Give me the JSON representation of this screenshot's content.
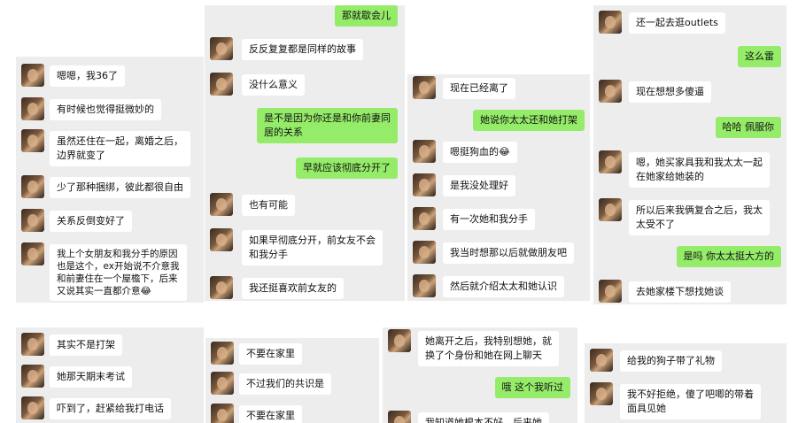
{
  "colors": {
    "panel_bg": "#ededed",
    "incoming_bubble": "#ffffff",
    "outgoing_bubble": "#95ec69"
  },
  "icons": {
    "avatar": "contact-avatar-photo"
  },
  "panels": {
    "p1": [
      {
        "dir": "in",
        "text": "嗯嗯，我36了"
      },
      {
        "dir": "in",
        "text": "有时候也觉得挺微妙的"
      },
      {
        "dir": "in",
        "text": "虽然还住在一起，离婚之后，\n边界就变了"
      },
      {
        "dir": "in",
        "text": "少了那种捆绑，彼此都很自由"
      },
      {
        "dir": "in",
        "text": "关系反倒变好了"
      },
      {
        "dir": "in",
        "text": "我上个女朋友和我分手的原因\n也是这个，ex开始说不介意我\n和前妻住在一个屋檐下，后来\n又说其实一直都介意😂"
      }
    ],
    "p2": [
      {
        "dir": "out",
        "text": "那就歇会儿"
      },
      {
        "dir": "in",
        "text": "反反复复都是同样的故事"
      },
      {
        "dir": "in",
        "text": "没什么意义"
      },
      {
        "dir": "out",
        "text": "是不是因为你还是和你前妻同\n居的关系"
      },
      {
        "dir": "out",
        "text": "早就应该彻底分开了"
      },
      {
        "dir": "in",
        "text": "也有可能"
      },
      {
        "dir": "in",
        "text": "如果早彻底分开，前女友不会\n和我分手"
      },
      {
        "dir": "in",
        "text": "我还挺喜欢前女友的"
      }
    ],
    "p3": [
      {
        "dir": "in",
        "text": "现在已经离了"
      },
      {
        "dir": "out",
        "text": "她说你太太还和她打架"
      },
      {
        "dir": "in",
        "text": "嗯挺狗血的😂"
      },
      {
        "dir": "in",
        "text": "是我没处理好"
      },
      {
        "dir": "in",
        "text": "有一次她和我分手"
      },
      {
        "dir": "in",
        "text": "我当时想那以后就做朋友吧"
      },
      {
        "dir": "in",
        "text": "然后就介绍太太和她认识"
      }
    ],
    "p4": [
      {
        "dir": "in",
        "text": "还一起去逛outlets"
      },
      {
        "dir": "out",
        "text": "这么雷"
      },
      {
        "dir": "in",
        "text": "现在想想多傻逼"
      },
      {
        "dir": "out",
        "text": "哈哈 佩服你"
      },
      {
        "dir": "in",
        "text": "嗯，她买家具我和我太太一起\n在她家给她装的"
      },
      {
        "dir": "in",
        "text": "所以后来我俩复合之后，我太\n太受不了"
      },
      {
        "dir": "out",
        "text": "是吗 你太太挺大方的"
      },
      {
        "dir": "in",
        "text": "去她家楼下想找她谈"
      }
    ],
    "p5": [
      {
        "dir": "in",
        "text": "其实不是打架"
      },
      {
        "dir": "in",
        "text": "她那天期末考试"
      },
      {
        "dir": "in",
        "text": "吓到了，赶紧给我打电话"
      }
    ],
    "p6": [
      {
        "dir": "in",
        "text": "不要在家里"
      },
      {
        "dir": "in",
        "text": "不过我们的共识是"
      },
      {
        "dir": "in",
        "text": "不要在家里"
      }
    ],
    "p7": [
      {
        "dir": "in",
        "text": "她离开之后，我特别想她，就\n换了个身份和她在网上聊天"
      },
      {
        "dir": "out",
        "text": "哦 这个我听过"
      },
      {
        "dir": "in",
        "text": "我知道她根本不好，后来她"
      }
    ],
    "p8": [
      {
        "dir": "in",
        "text": "给我的狗子带了礼物"
      },
      {
        "dir": "in",
        "text": "我不好拒绝，傻了吧唧的带着\n面具见她"
      }
    ]
  }
}
